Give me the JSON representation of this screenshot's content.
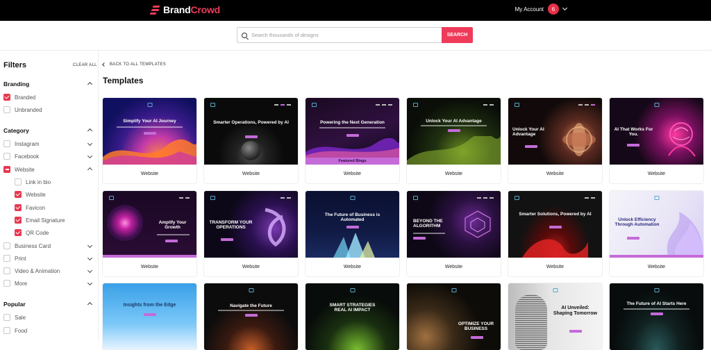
{
  "brand": {
    "name_part1": "Brand",
    "name_part2": "Crowd"
  },
  "account": {
    "label": "My Account",
    "count": "6"
  },
  "search": {
    "placeholder": "Search thousands of designs",
    "button": "SEARCH"
  },
  "sidebar": {
    "title": "Filters",
    "clear_all": "CLEAR ALL",
    "branding": {
      "title": "Branding",
      "items": [
        {
          "label": "Branded",
          "checked": true
        },
        {
          "label": "Unbranded",
          "checked": false
        }
      ]
    },
    "category": {
      "title": "Category",
      "items": [
        {
          "label": "Instagram"
        },
        {
          "label": "Facebook"
        },
        {
          "label": "Website"
        },
        {
          "label": "Link in bio"
        },
        {
          "label": "Website"
        },
        {
          "label": "Favicon"
        },
        {
          "label": "Email Signature"
        },
        {
          "label": "QR Code"
        },
        {
          "label": "Business Card"
        },
        {
          "label": "Print"
        },
        {
          "label": "Video & Animation"
        },
        {
          "label": "More"
        }
      ]
    },
    "popular": {
      "title": "Popular",
      "items": [
        {
          "label": "Sale"
        },
        {
          "label": "Food"
        }
      ]
    }
  },
  "main": {
    "back_label": "BACK TO ALL TEMPLATES",
    "title": "Templates",
    "cards": [
      {
        "label": "Website",
        "headline": "Simplify Your AI Journey"
      },
      {
        "label": "Website",
        "headline": "Smarter Operations, Powered by AI"
      },
      {
        "label": "Website",
        "headline": "Powering the Next Generation",
        "strip": "Featured Blogs"
      },
      {
        "label": "Website",
        "headline": "Unlock Your AI Advantage"
      },
      {
        "label": "Website",
        "headline": "Unlock Your AI Advantage"
      },
      {
        "label": "Website",
        "headline": "AI That Works For You."
      },
      {
        "label": "Website",
        "headline": "Amplify Your Growth"
      },
      {
        "label": "Website",
        "headline": "TRANSFORM YOUR OPERATIONS"
      },
      {
        "label": "Website",
        "headline": "The Future of Business is Automated"
      },
      {
        "label": "Website",
        "headline": "BEYOND THE ALGORITHM"
      },
      {
        "label": "Website",
        "headline": "Smarter Solutions, Powered by AI"
      },
      {
        "label": "Website",
        "headline": "Unlock Efficiency Through Automation"
      },
      {
        "label": "",
        "headline": "Insights from the Edge"
      },
      {
        "label": "",
        "headline": "Navigate the Future"
      },
      {
        "label": "",
        "headline": "SMART STRATEGIES REAL AI IMPACT"
      },
      {
        "label": "",
        "headline": "OPTIMIZE YOUR BUSINESS"
      },
      {
        "label": "",
        "headline": "AI Unveiled: Shaping Tomorrow"
      },
      {
        "label": "",
        "headline": "The Future of AI Starts Here"
      }
    ]
  },
  "colors": {
    "brand_red": "#ef3b5a",
    "accent_purple": "#c46bd8"
  }
}
